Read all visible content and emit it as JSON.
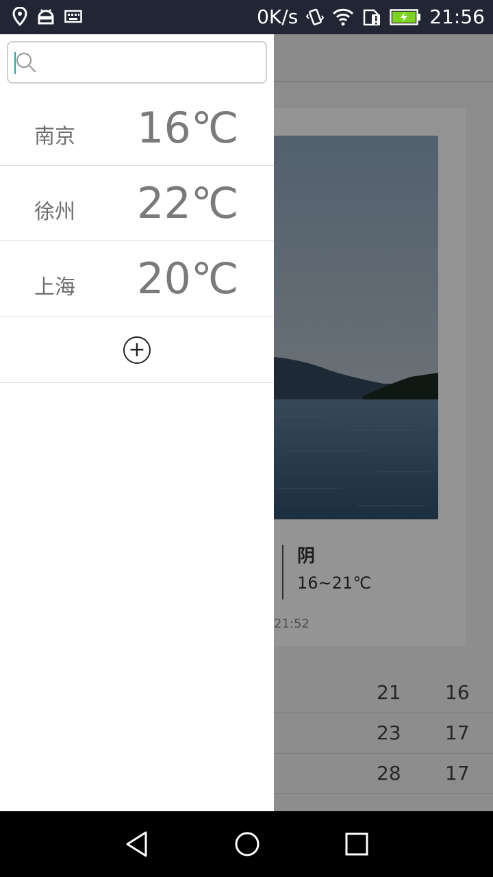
{
  "status_bar": {
    "left_icons": [
      "location-icon",
      "android-icon",
      "keyboard-icon"
    ],
    "net_speed": "0K/s",
    "right_icons": [
      "vibrate-icon",
      "wifi-icon",
      "sim-alert-icon",
      "battery-charging-icon"
    ],
    "time": "21:56"
  },
  "search": {
    "value": "",
    "placeholder": ""
  },
  "cities": [
    {
      "name": "南京",
      "temp": "16℃"
    },
    {
      "name": "徐州",
      "temp": "22℃"
    },
    {
      "name": "上海",
      "temp": "20℃"
    }
  ],
  "add_button": {
    "icon": "plus-circle-icon",
    "symbol": "+"
  },
  "background_app": {
    "condition": "阴",
    "temp_range": "16~21℃",
    "updated_time": "21:52",
    "forecast": [
      {
        "high": "21",
        "low": "16"
      },
      {
        "high": "23",
        "low": "17"
      },
      {
        "high": "28",
        "low": "17"
      }
    ]
  },
  "nav": {
    "icons": [
      "back-icon",
      "home-icon",
      "recents-icon"
    ]
  },
  "colors": {
    "status_bar": "#222634",
    "drawer_bg": "#ffffff",
    "accent": "#2aa69a",
    "battery": "#7dd321"
  }
}
